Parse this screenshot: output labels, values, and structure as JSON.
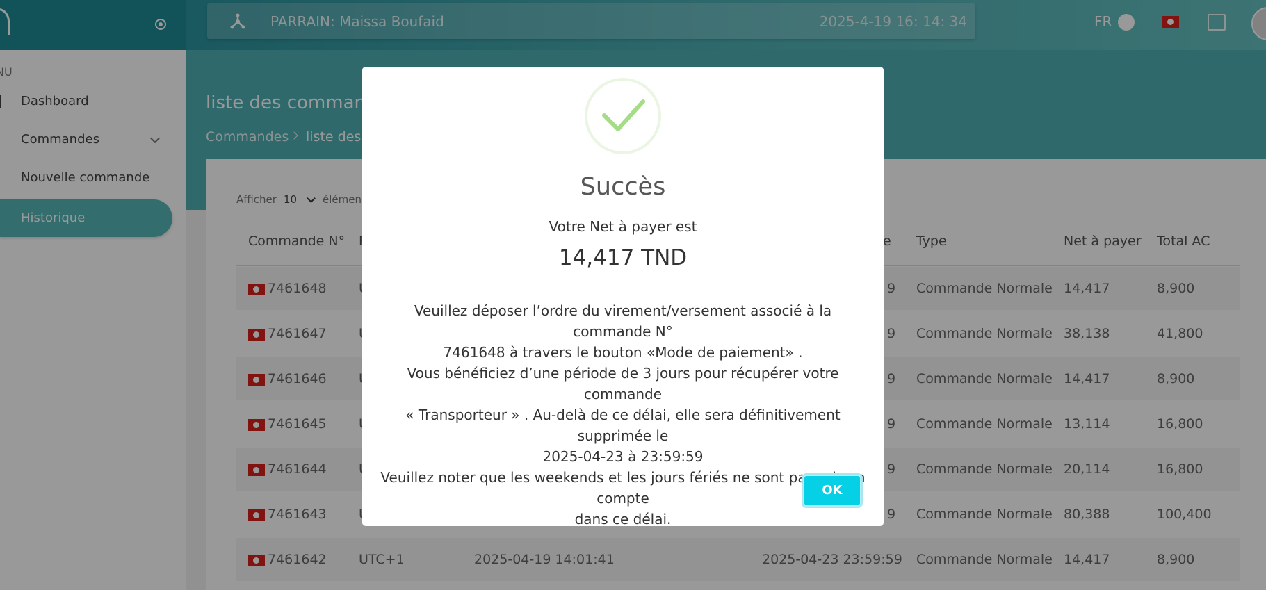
{
  "header": {
    "sponsor": "PARRAIN: Maissa Boufaid",
    "datetime": "2025-4-19 16: 14: 34",
    "language": "FR"
  },
  "sidebar": {
    "menu_label": "NU",
    "items": [
      {
        "label": "Dashboard"
      },
      {
        "label": "Commandes"
      },
      {
        "label": "Nouvelle commande"
      },
      {
        "label": "Historique"
      }
    ]
  },
  "page": {
    "title": "liste des command",
    "breadcrumb": [
      "Commandes",
      "liste des c"
    ],
    "show_label": "Afficher",
    "show_value": "10",
    "show_suffix": "élément"
  },
  "table": {
    "headers": [
      {
        "text": "Commande N°"
      },
      {
        "text": "F"
      },
      {
        "text": "e"
      },
      {
        "text": "Type"
      },
      {
        "text": "Net à payer"
      },
      {
        "text": "Total AC"
      }
    ],
    "rows": [
      {
        "num": "7461648",
        "tz": "U",
        "date": "",
        "deadline": "9",
        "type": "Commande Normale",
        "net": "14,417",
        "total": "8,900"
      },
      {
        "num": "7461647",
        "tz": "U",
        "date": "",
        "deadline": "9",
        "type": "Commande Normale",
        "net": "38,138",
        "total": "41,800"
      },
      {
        "num": "7461646",
        "tz": "U",
        "date": "",
        "deadline": "9",
        "type": "Commande Normale",
        "net": "14,417",
        "total": "8,900"
      },
      {
        "num": "7461645",
        "tz": "U",
        "date": "",
        "deadline": "9",
        "type": "Commande Normale",
        "net": "13,114",
        "total": "16,800"
      },
      {
        "num": "7461644",
        "tz": "U",
        "date": "",
        "deadline": "9",
        "type": "Commande Normale",
        "net": "20,114",
        "total": "16,800"
      },
      {
        "num": "7461643",
        "tz": "U",
        "date": "",
        "deadline": "9",
        "type": "Commande Normale",
        "net": "80,388",
        "total": "100,400"
      },
      {
        "num": "7461642",
        "tz": "UTC+1",
        "date": "2025-04-19 14:01:41",
        "deadline": "2025-04-23 23:59:59",
        "type": "Commande Normale",
        "net": "14,417",
        "total": "8,900"
      }
    ]
  },
  "modal": {
    "title": "Succès",
    "subtitle": "Votre Net à payer est",
    "amount": "14,417 TND",
    "message": [
      "Veuillez déposer l’ordre du virement/versement associé à la commande N°",
      "7461648 à travers le bouton «Mode de paiement» .",
      "Vous bénéficiez d’une période de 3 jours pour récupérer votre commande",
      "« Transporteur » . Au-delà de ce délai, elle sera définitivement supprimée le",
      "2025-04-23 à 23:59:59",
      "Veuillez noter que les weekends et les jours fériés ne sont pas pris en compte",
      "dans ce délai."
    ],
    "ok_label": "OK"
  },
  "colors": {
    "teal": "#4fb0b5",
    "ok_button": "#06d0e6",
    "success_check": "#a5dc86",
    "flag_red": "#d8201c"
  }
}
